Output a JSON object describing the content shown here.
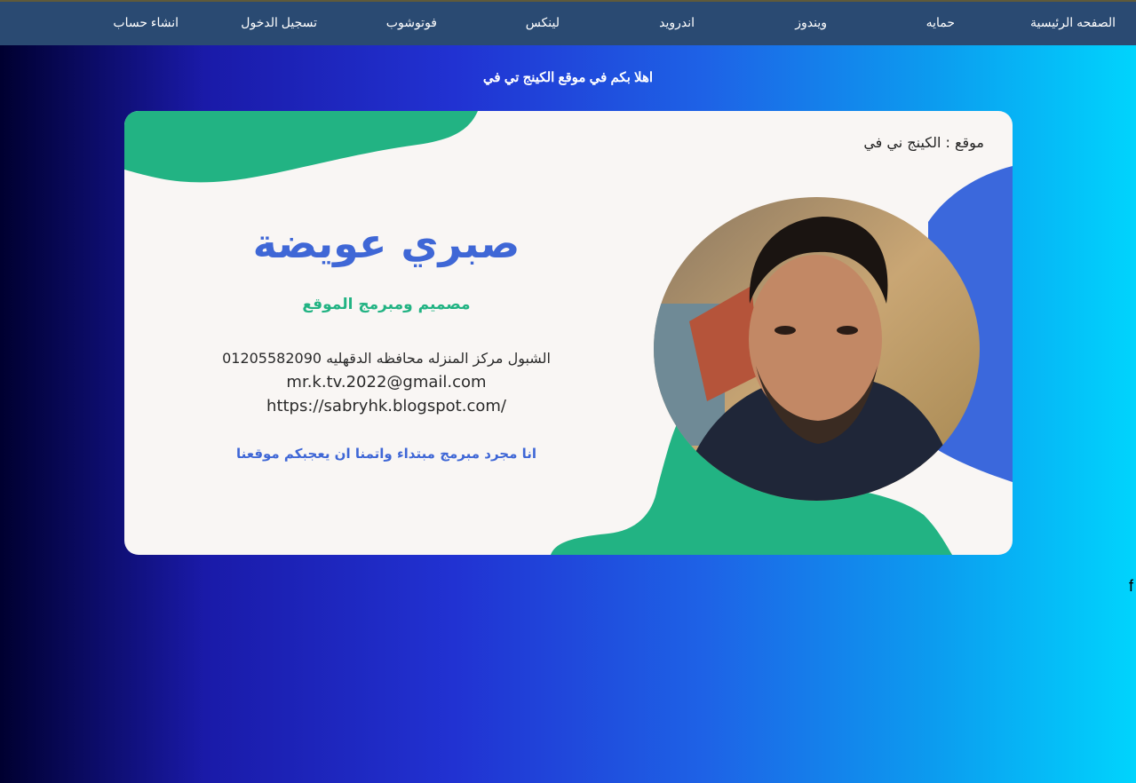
{
  "nav": {
    "items": [
      {
        "label": "الصفحه الرئيسية"
      },
      {
        "label": "حمايه"
      },
      {
        "label": "ويندوز"
      },
      {
        "label": "اندرويد"
      },
      {
        "label": "لينكس"
      },
      {
        "label": "فوتوشوب"
      },
      {
        "label": "تسجيل الدخول"
      },
      {
        "label": "انشاء حساب"
      }
    ]
  },
  "welcome_text": "اهلا بكم في موقع الكينج تي في",
  "card": {
    "site_label": "موقع : الكينج ني في",
    "name": "صبري عويضة",
    "subtitle": "مصميم ومبرمج الموقع",
    "address": "الشبول مركز المنزله محافظه الدقهليه 01205582090",
    "email": "mr.k.tv.2022@gmail.com",
    "url": "https://sabryhk.blogspot.com/",
    "tagline": "انا مجرد مبرمج مبتداء واتمنا ان يعجبكم موقعنا"
  },
  "stray_text": "f",
  "colors": {
    "navbar": "#2a4a72",
    "card_bg": "#f9f6f4",
    "accent_blue": "#3f67d6",
    "accent_green": "#22b383"
  }
}
